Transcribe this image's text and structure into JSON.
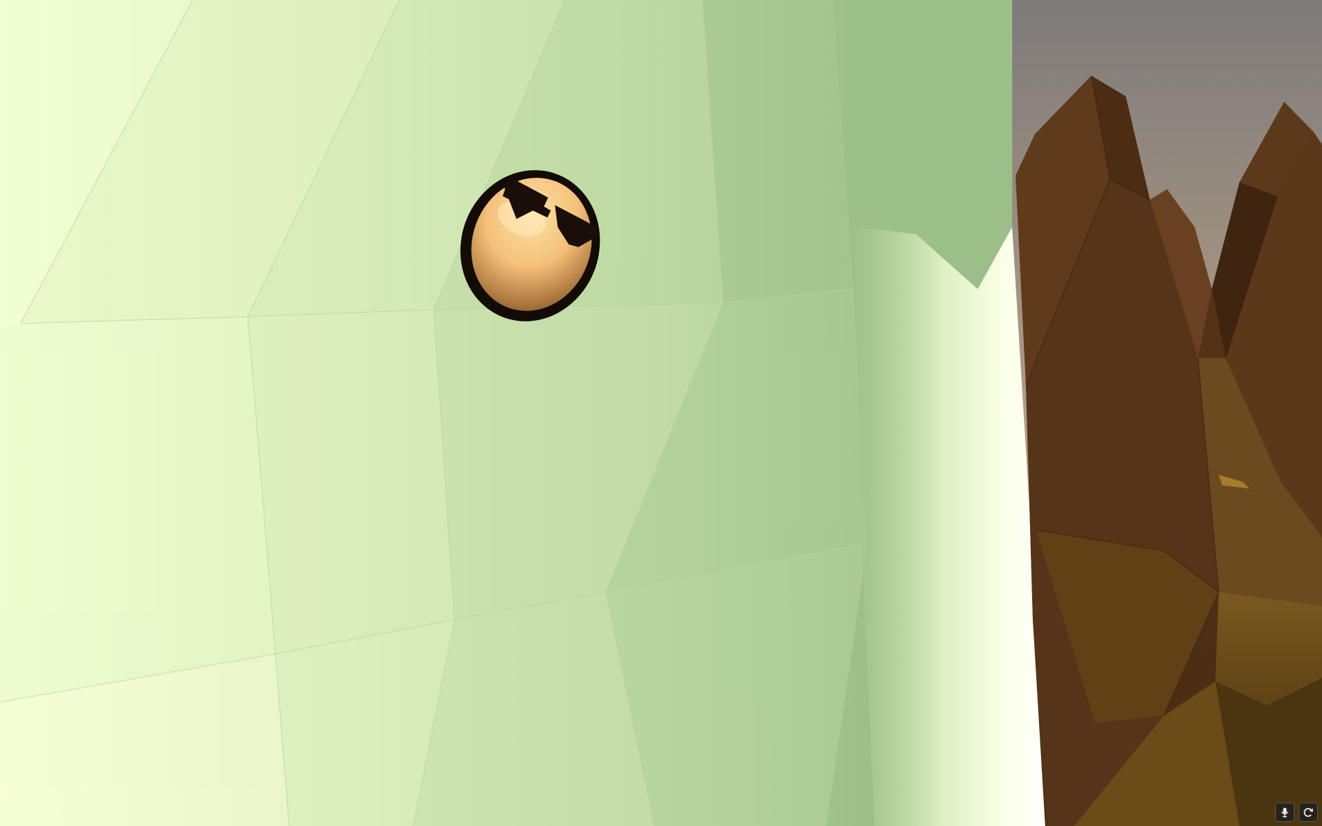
{
  "scene": {
    "type": "3d-game-view",
    "sky_colors": [
      "#7f7a78",
      "#b8a282",
      "#e6cfa0"
    ],
    "terrain_colors": [
      "#eefcc8",
      "#d6eab4",
      "#b8d39e",
      "#98bc86"
    ],
    "rock_colors": [
      "#4f2f18",
      "#5b3a1c",
      "#6e4a22",
      "#8a6a1e"
    ],
    "character": {
      "name": "egg",
      "accessory": "sunglasses",
      "body_color": "#f6c878",
      "outline_color": "#120b06"
    }
  },
  "hud": {
    "buttons": [
      {
        "name": "microphone",
        "icon": "microphone-icon"
      },
      {
        "name": "refresh",
        "icon": "refresh-icon"
      }
    ]
  }
}
